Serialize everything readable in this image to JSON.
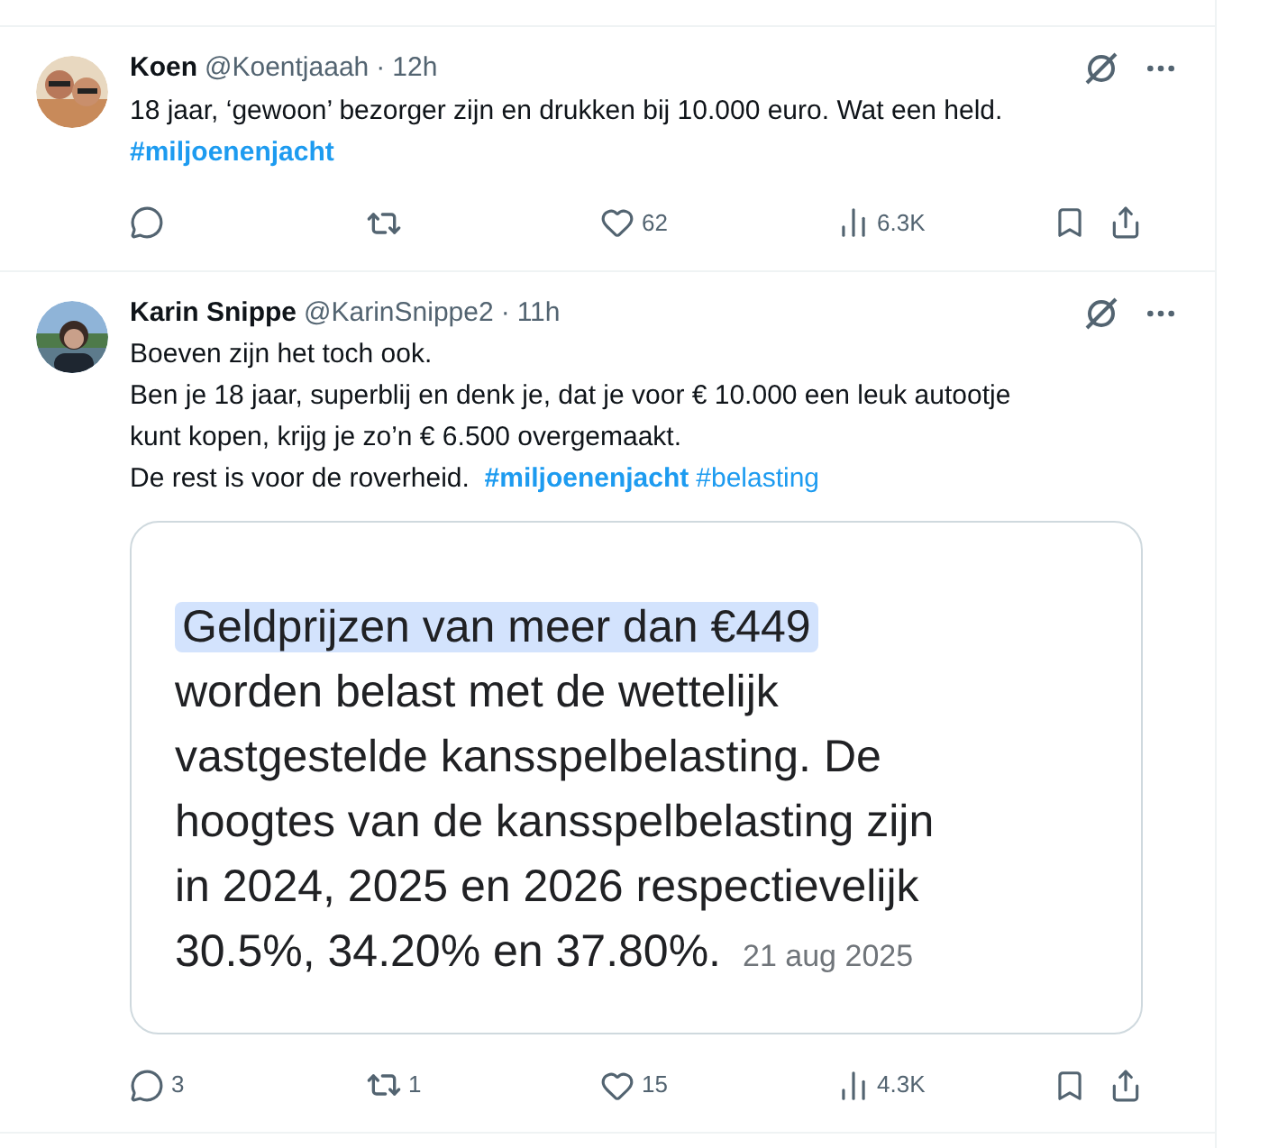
{
  "tweets": [
    {
      "author": "Koen",
      "handle": "@Koentjaaah",
      "separator": "·",
      "time": "12h",
      "lines": [
        [
          {
            "text": "18 jaar, ‘gewoon’ bezorger zijn en drukken bij 10.000 euro. Wat een held.",
            "kind": "text"
          }
        ],
        [
          {
            "text": "#miljoenenjacht",
            "kind": "hashtag",
            "bold": true
          }
        ]
      ],
      "stats": {
        "likes": "62",
        "views": "6.3K"
      }
    },
    {
      "author": "Karin Snippe",
      "handle": "@KarinSnippe2",
      "separator": "·",
      "time": "11h",
      "lines": [
        [
          {
            "text": "Boeven zijn het toch ook.",
            "kind": "text"
          }
        ],
        [
          {
            "text": "Ben je 18 jaar, superblij en denk je, dat je voor € 10.000 een leuk autootje",
            "kind": "text"
          }
        ],
        [
          {
            "text": "kunt kopen, krijg je zo’n € 6.500 overgemaakt.",
            "kind": "text"
          }
        ],
        [
          {
            "text": "De rest is voor de roverheid.  ",
            "kind": "text"
          },
          {
            "text": "#miljoenenjacht",
            "kind": "hashtag",
            "bold": true
          },
          {
            "text": "#belasting",
            "kind": "hashtag",
            "bold": false
          }
        ]
      ],
      "media": {
        "highlight": "Geldprijzen van meer dan €449",
        "lines": [
          "worden belast met de wettelijk",
          "vastgestelde kansspelbelasting. De",
          "hoogtes van de kansspelbelasting zijn",
          "in 2024, 2025 en 2026 respectievelijk",
          "30.5%, 34.20% en 37.80%."
        ],
        "date": "21 aug 2025"
      },
      "stats": {
        "replies": "3",
        "reposts": "1",
        "likes": "15",
        "views": "4.3K"
      }
    }
  ]
}
